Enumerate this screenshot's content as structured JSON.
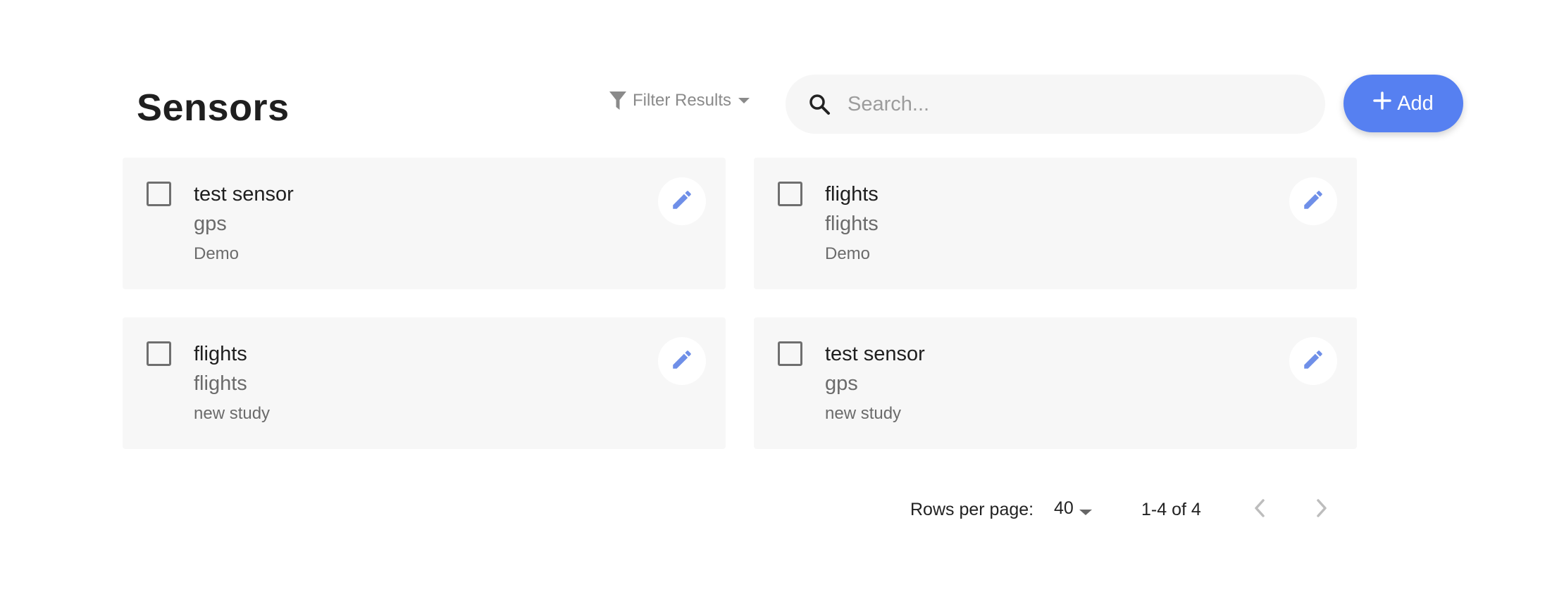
{
  "header": {
    "title": "Sensors",
    "filter_label": "Filter Results",
    "search_placeholder": "Search...",
    "search_value": "",
    "add_label": "Add"
  },
  "cards": [
    {
      "name": "test sensor",
      "type": "gps",
      "study": "Demo"
    },
    {
      "name": "flights",
      "type": "flights",
      "study": "Demo"
    },
    {
      "name": "flights",
      "type": "flights",
      "study": "new study"
    },
    {
      "name": "test sensor",
      "type": "gps",
      "study": "new study"
    }
  ],
  "pagination": {
    "rows_label": "Rows per page:",
    "rows_value": "40",
    "range": "1-4 of 4"
  },
  "colors": {
    "accent": "#5680f1",
    "edit_icon": "#6f8fe8",
    "card_bg": "#f7f7f7"
  },
  "icons": {
    "filter": "funnel-icon",
    "search": "search-icon",
    "add": "plus-icon",
    "edit": "pencil-icon",
    "prev": "chevron-left-icon",
    "next": "chevron-right-icon"
  }
}
